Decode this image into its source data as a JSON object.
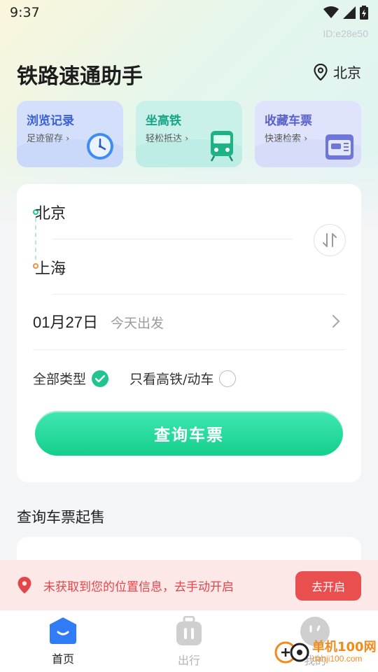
{
  "status_bar": {
    "time": "9:37"
  },
  "device_id": "ID:e28e50",
  "header": {
    "title": "铁路速通助手",
    "city": "北京"
  },
  "quick_cards": [
    {
      "title": "浏览记录",
      "subtitle": "足迹留存 ›",
      "icon": "alarm-clock-icon"
    },
    {
      "title": "坐高铁",
      "subtitle": "轻松抵达 ›",
      "icon": "train-icon"
    },
    {
      "title": "收藏车票",
      "subtitle": "快速检索 ›",
      "icon": "ticket-icon"
    }
  ],
  "search": {
    "from_station": "北京",
    "to_station": "上海",
    "date": "01月27日",
    "date_hint": "今天出发",
    "filter_all_label": "全部类型",
    "filter_all_checked": true,
    "filter_fast_label": "只看高铁/动车",
    "filter_fast_checked": false,
    "query_button": "查询车票"
  },
  "presale": {
    "section_title": "查询车票起售"
  },
  "location_banner": {
    "message": "未获取到您的位置信息，去手动开启",
    "button": "去开启"
  },
  "tabs": [
    {
      "label": "首页",
      "active": true
    },
    {
      "label": "出行",
      "active": false
    },
    {
      "label": "我的",
      "active": false
    }
  ],
  "watermark": {
    "main": "单机100网",
    "sub": "danji100.com"
  },
  "colors": {
    "accent_green": "#1fc491",
    "accent_blue": "#2f7cf6",
    "alert_red": "#e94f4f",
    "watermark_orange": "#f28a1c"
  }
}
